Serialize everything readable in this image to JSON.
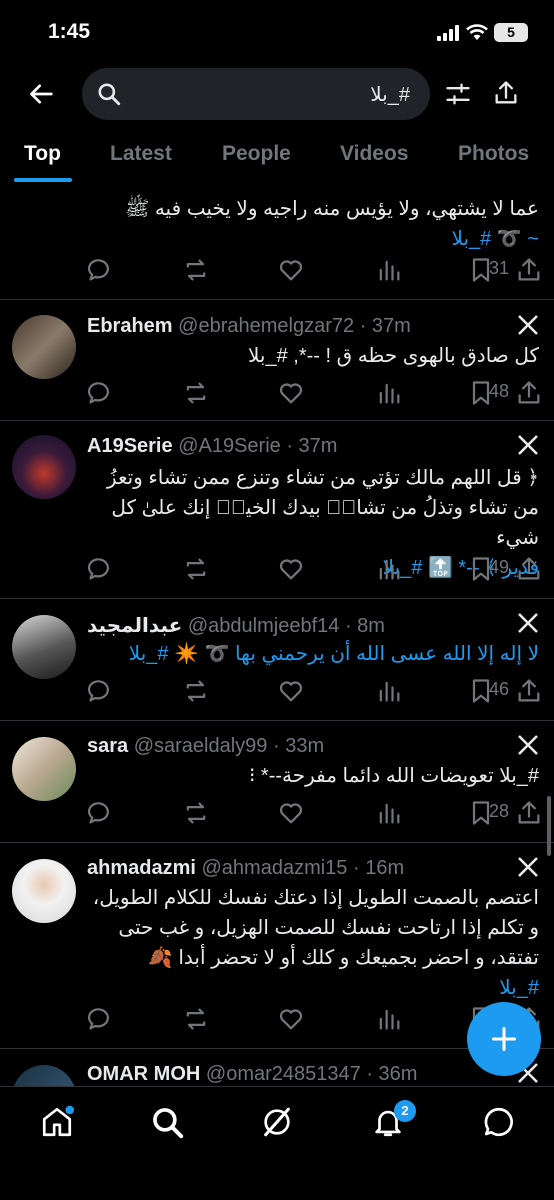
{
  "status_bar": {
    "time": "1:45",
    "battery": "5"
  },
  "search": {
    "query": "#_بلا"
  },
  "tabs": [
    {
      "label": "Top",
      "active": true
    },
    {
      "label": "Latest",
      "active": false
    },
    {
      "label": "People",
      "active": false
    },
    {
      "label": "Videos",
      "active": false
    },
    {
      "label": "Photos",
      "active": false
    }
  ],
  "posts": [
    {
      "lines": [
        "عما لا يشتهي، ولا يؤيس منه راجيه ولا يخيب فيه ﷺ",
        "~ ➰ #_بلا"
      ],
      "views": "31"
    },
    {
      "name": "Ebrahem",
      "handle": "@ebrahemelgzar72",
      "time": "· 37m",
      "lines": [
        "كل صادق بالهوى حظه ق ! --*, #_بلا"
      ],
      "views": "48"
    },
    {
      "name": "A19Serie",
      "handle": "@A19Serie",
      "time": "· 37m",
      "lines": [
        "﴿ قل اللهم مالك  تؤتي  من تشاء وتنزع  ممن تشاء وتعزُ",
        "من تشاء وتذلُ من تشاءۖ  بيدك الخيرۖ  إنك علىٰ كل شيء",
        "قدير ﴾ --* 🔝 #_بلا"
      ],
      "views": "49"
    },
    {
      "name": "عبدالمجيد",
      "handle": "@abdulmjeebf14",
      "time": "· 8m",
      "lines": [
        "لا إله إلا الله   عسى الله أن يرحمني بها  ➰ ✴️ #_بلا"
      ],
      "views": "46"
    },
    {
      "name": "sara",
      "handle": "@saraeldaly99",
      "time": "· 33m",
      "lines": [
        "#_بلا  تعويضات الله دائما مفرحة--* ⁝"
      ],
      "views": "28"
    },
    {
      "name": "ahmadazmi",
      "handle": "@ahmadazmi15",
      "time": "· 16m",
      "lines": [
        "اعتصم بالصمت الطويل إذا دعتك نفسك للكلام الطويل،",
        "و تكلم إذا ارتاحت نفسك للصمت الهزيل، و غب حتى",
        "تفتقد، و احضر بجميعك و كلك أو لا تحضر أبدا 🍂",
        "#_بلا"
      ],
      "views": "52"
    },
    {
      "name": "OMAR MOH",
      "handle": "@omar24851347",
      "time": "· 36m",
      "lines": [],
      "views": ""
    }
  ],
  "nav": {
    "notifications_badge": "2"
  },
  "colors": {
    "accent": "#1d9bf0",
    "muted": "#71767b",
    "bg": "#000000"
  }
}
